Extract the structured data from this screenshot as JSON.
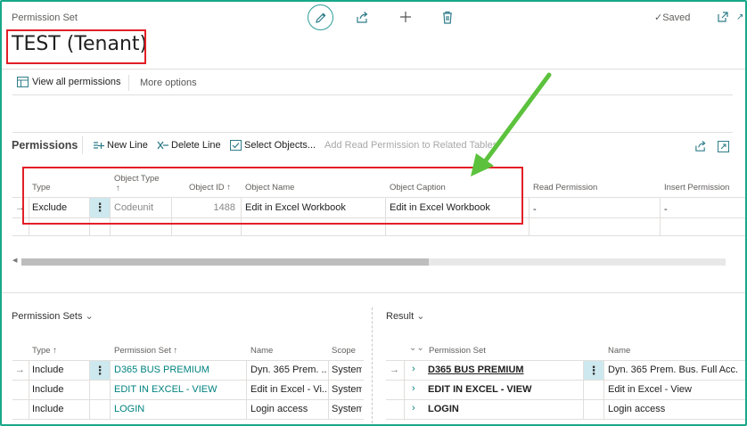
{
  "header": {
    "page_type": "Permission Set",
    "title": "TEST (Tenant)",
    "saved": "Saved"
  },
  "actions": {
    "view_all": "View all permissions",
    "more_options": "More options"
  },
  "permissions": {
    "title": "Permissions",
    "new_line": "New Line",
    "delete_line": "Delete Line",
    "select_objects": "Select Objects...",
    "add_read": "Add Read Permission to Related Tables",
    "columns": {
      "type": "Type",
      "object_type": "Object Type",
      "object_id": "Object ID",
      "object_name": "Object Name",
      "object_caption": "Object Caption",
      "read_permission": "Read Permission",
      "insert_permission": "Insert Permission"
    },
    "rows": [
      {
        "type": "Exclude",
        "object_type": "Codeunit",
        "object_id": "1488",
        "object_name": "Edit in Excel Workbook",
        "object_caption": "Edit in Excel Workbook",
        "read": "-",
        "insert": "-"
      }
    ]
  },
  "permission_sets": {
    "title": "Permission Sets",
    "columns": {
      "type": "Type",
      "set": "Permission Set",
      "name": "Name",
      "scope": "Scope"
    },
    "rows": [
      {
        "type": "Include",
        "set": "D365 BUS PREMIUM",
        "name": "Dyn. 365 Prem. ...",
        "scope": "System"
      },
      {
        "type": "Include",
        "set": "EDIT IN EXCEL - VIEW",
        "name": "Edit in Excel - Vi...",
        "scope": "System"
      },
      {
        "type": "Include",
        "set": "LOGIN",
        "name": "Login access",
        "scope": "System"
      }
    ]
  },
  "result": {
    "title": "Result",
    "columns": {
      "set": "Permission Set",
      "name": "Name"
    },
    "rows": [
      {
        "set": "D365 BUS PREMIUM",
        "name": "Dyn. 365 Prem. Bus. Full Acc."
      },
      {
        "set": "EDIT IN EXCEL - VIEW",
        "name": "Edit in Excel - View"
      },
      {
        "set": "LOGIN",
        "name": "Login access"
      }
    ]
  },
  "colors": {
    "frame": "#18a889",
    "highlight": "#e21f26",
    "arrow": "#5cc23d",
    "accent": "#00827f"
  }
}
